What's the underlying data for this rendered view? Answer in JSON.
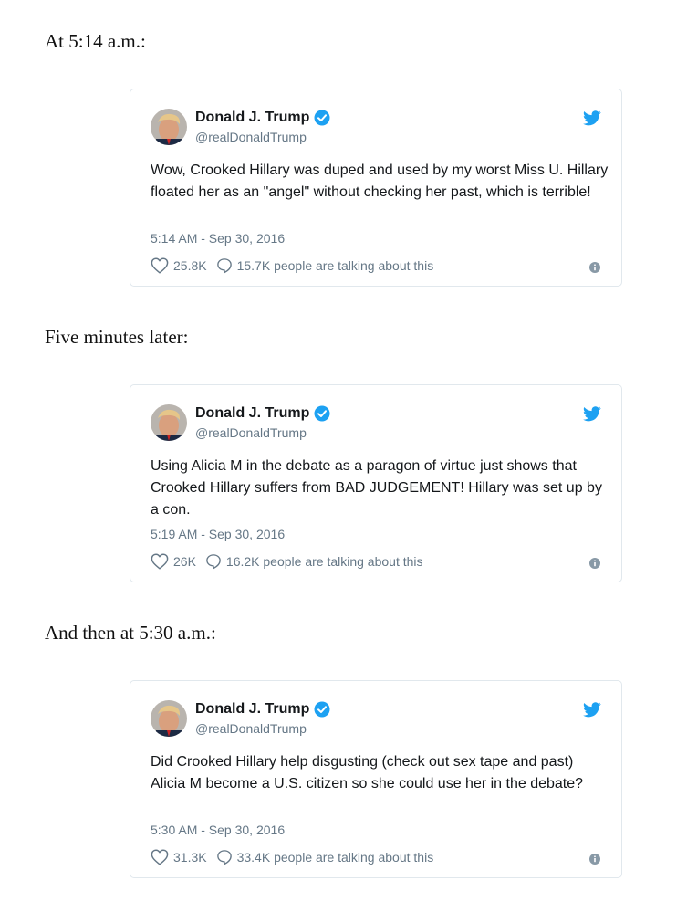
{
  "sections": [
    {
      "intro": "At 5:14 a.m.:",
      "tweet": {
        "name": "Donald J. Trump",
        "handle": "@realDonaldTrump",
        "text": "Wow, Crooked Hillary was duped and used by my worst Miss U. Hillary floated her as an \"angel\" without checking her past, which is terrible!",
        "timestamp": "5:14 AM - Sep 30, 2016",
        "likes": "25.8K",
        "talking": "15.7K people are talking about this"
      }
    },
    {
      "intro": "Five minutes later:",
      "tweet": {
        "name": "Donald J. Trump",
        "handle": "@realDonaldTrump",
        "text": "Using Alicia M in the debate as a paragon of virtue just shows that Crooked Hillary suffers from BAD JUDGEMENT! Hillary was set up by a con.",
        "timestamp": "5:19 AM - Sep 30, 2016",
        "likes": "26K",
        "talking": "16.2K people are talking about this"
      }
    },
    {
      "intro": "And then at 5:30 a.m.:",
      "tweet": {
        "name": "Donald J. Trump",
        "handle": "@realDonaldTrump",
        "text": "Did Crooked Hillary help disgusting (check out sex tape and past) Alicia M become a U.S. citizen so she could use her in the debate?",
        "timestamp": "5:30 AM - Sep 30, 2016",
        "likes": "31.3K",
        "talking": "33.4K people are talking about this"
      }
    }
  ],
  "icons": {
    "verified": "verified-badge-icon",
    "twitter": "twitter-bird-icon",
    "like": "heart-icon",
    "reply": "speech-bubble-icon",
    "info": "info-icon"
  },
  "colors": {
    "twitter_blue": "#1da1f2",
    "text": "#14171a",
    "muted": "#657786",
    "border": "#e1e8ed"
  }
}
